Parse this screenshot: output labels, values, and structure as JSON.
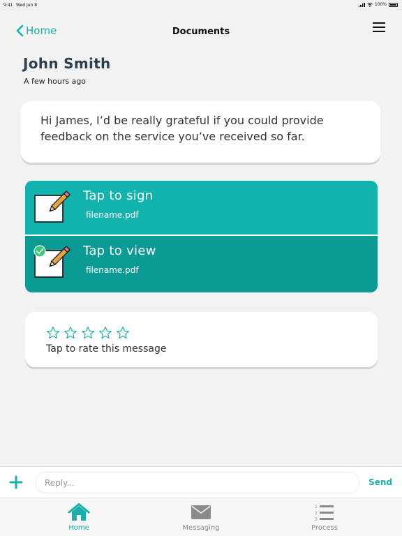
{
  "status_bar": {
    "time": "9:41",
    "date": "Wed Jun 8",
    "battery": "100%"
  },
  "nav": {
    "back_label": "Home",
    "title": "Documents"
  },
  "message": {
    "sender": "John Smith",
    "timestamp": "A few hours ago",
    "body": "Hi James, I’d be really grateful if you could provide feedback on the service you’ve received so far."
  },
  "documents": [
    {
      "action": "Tap to sign",
      "filename": "filename.pdf",
      "signed": false
    },
    {
      "action": "Tap to view",
      "filename": "filename.pdf",
      "signed": true
    }
  ],
  "rating": {
    "label": "Tap to rate this message",
    "stars_total": 5,
    "stars_filled": 0
  },
  "reply": {
    "placeholder": "Reply...",
    "send_label": "Send"
  },
  "tabs": [
    {
      "label": "Home",
      "icon": "house-icon",
      "active": true
    },
    {
      "label": "Messaging",
      "icon": "envelope-icon",
      "active": false
    },
    {
      "label": "Process",
      "icon": "numbered-list-icon",
      "active": false
    }
  ],
  "colors": {
    "accent": "#19b0ab",
    "sign_row": "#12b2ad",
    "view_row": "#0b9a94",
    "check": "#3cc878"
  }
}
